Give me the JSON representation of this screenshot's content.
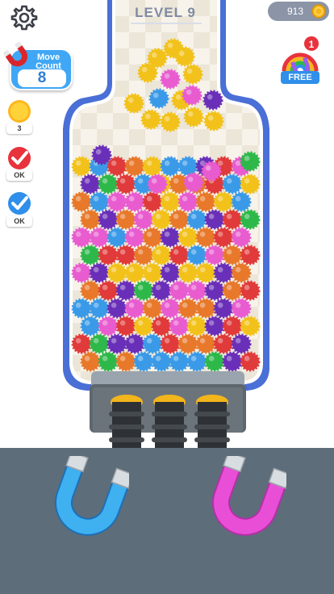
{
  "header": {
    "level_title": "LEVEL 9",
    "coins": "913"
  },
  "move_count": {
    "label_line1": "Move",
    "label_line2": "Count",
    "value": "8"
  },
  "boosters": [
    {
      "icon": "sun-coin-icon",
      "tag": "3"
    },
    {
      "icon": "red-check-icon",
      "tag": "OK"
    },
    {
      "icon": "blue-check-icon",
      "tag": "OK"
    }
  ],
  "free_booster": {
    "badge": "1",
    "label": "FREE"
  },
  "magnets": [
    {
      "name": "blue-magnet",
      "color": "#3fb0f0"
    },
    {
      "name": "pink-magnet",
      "color": "#e84fd6"
    }
  ],
  "colors": {
    "bottle_frame": "#4a6fd6",
    "bottle_inner": "#f5f1e8",
    "tray": "#5d6d79",
    "balls": {
      "yellow": "#f2c21b",
      "purple": "#6a2fb8",
      "blue": "#3a9ae8",
      "red": "#e03a3a",
      "orange": "#e8782a",
      "pink": "#e85cd0",
      "green": "#2eb84a"
    }
  }
}
